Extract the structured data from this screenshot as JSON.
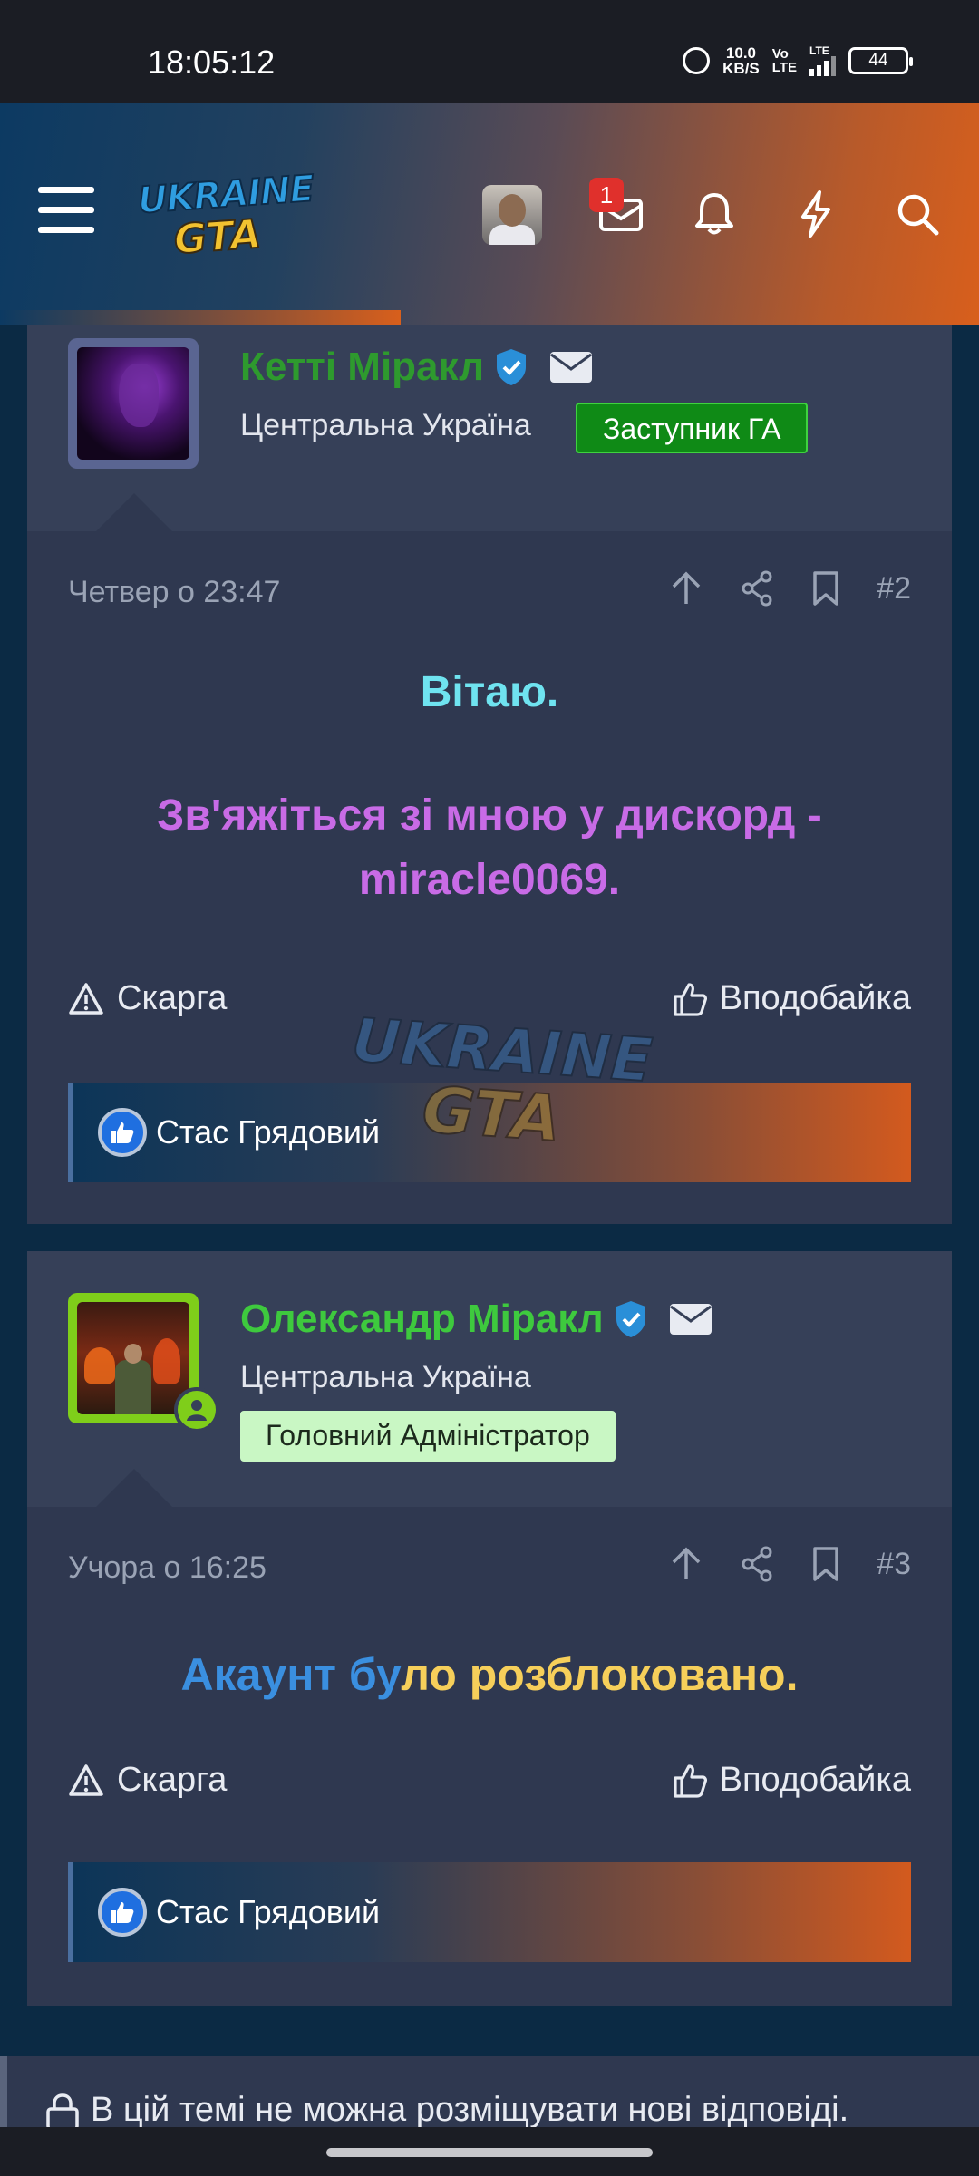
{
  "status_bar": {
    "time": "18:05:12",
    "net_speed_value": "10.0",
    "net_speed_unit": "KB/S",
    "volte_top": "Vo",
    "volte_bottom": "LTE",
    "network": "LTE",
    "battery": "44"
  },
  "header": {
    "logo_line1": "UKRAINE",
    "logo_line2": "GTA",
    "messages_badge": "1",
    "icons": [
      "menu-icon",
      "avatar",
      "mail-icon",
      "bell-icon",
      "bolt-icon",
      "search-icon"
    ]
  },
  "posts": [
    {
      "username": "Кетті Міракл",
      "username_color": "#2e9a2e",
      "location": "Центральна Україна",
      "role": "Заступник ГА",
      "role_bg": "#0f8a16",
      "role_color": "#ffffff",
      "date": "Четвер о 23:47",
      "number": "#2",
      "message_line1": "Вітаю.",
      "message_line1_color": "#6fe3f0",
      "message_line2": "Зв'яжіться зі мною у дискорд -",
      "message_line3": "miracle0069.",
      "message_color": "#c86be6",
      "report": "Скарга",
      "like": "Вподобайка",
      "liked_by": "Стас Грядовий"
    },
    {
      "username": "Олександр Міракл",
      "username_color": "#3ec93e",
      "location": "Центральна Україна",
      "role": "Головний Адміністратор",
      "role_bg": "#c9f7c4",
      "role_color": "#1c2a1c",
      "date": "Учора о 16:25",
      "number": "#3",
      "message_part1": "Акаунт бу",
      "message_part1_color": "#3a8fe0",
      "message_part2": "ло розблоковано.",
      "message_part2_color": "#f6cf5a",
      "report": "Скарга",
      "like": "Вподобайка",
      "liked_by": "Стас Грядовий"
    }
  ],
  "watermark": {
    "line1": "UKRAINE",
    "line2": "GTA"
  },
  "locked_notice": "В цій темі не можна розміщувати нові відповіді."
}
